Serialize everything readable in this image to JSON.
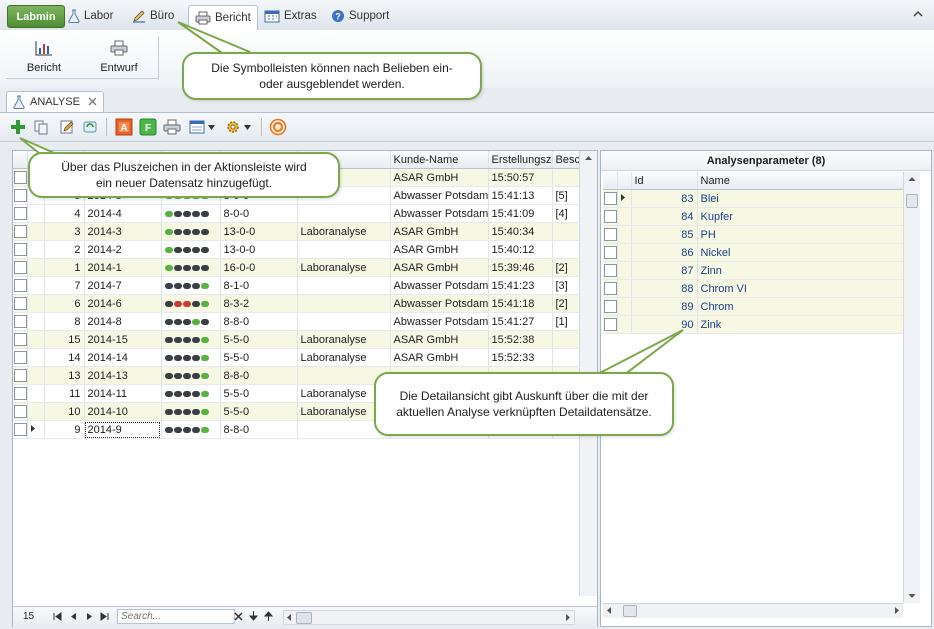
{
  "menu": {
    "app_label": "Labmin",
    "tabs": [
      {
        "label": "Labor",
        "icon": "flask-icon"
      },
      {
        "label": "Büro",
        "icon": "pen-icon"
      },
      {
        "label": "Bericht",
        "icon": "printer-icon"
      },
      {
        "label": "Extras",
        "icon": "calendar-icon"
      },
      {
        "label": "Support",
        "icon": "help-icon"
      }
    ],
    "active_tab": "Bericht"
  },
  "ribbon": {
    "buttons": [
      {
        "label": "Bericht",
        "icon": "chart-icon"
      },
      {
        "label": "Entwurf",
        "icon": "printer-icon"
      }
    ]
  },
  "doc_tab": {
    "label": "ANALYSE",
    "icon": "flask-icon"
  },
  "grid": {
    "columns": [
      "",
      "",
      "",
      "",
      "",
      "",
      "Kunde-Name",
      "Erstellungsze",
      "Besc"
    ],
    "rows": [
      {
        "id": "",
        "code": "",
        "dots": "",
        "status": "",
        "type": "",
        "customer": "ASAR GmbH",
        "time": "15:50:57",
        "desc": "",
        "yellow": true
      },
      {
        "id": "5",
        "code": "2014-5",
        "dots": "ggggg",
        "status": "8-0-0",
        "type": "",
        "customer": "Abwasser Potsdam",
        "time": "15:41:13",
        "desc": "[5]",
        "yellow": false
      },
      {
        "id": "4",
        "code": "2014-4",
        "dots": "gkkkk",
        "status": "8-0-0",
        "type": "",
        "customer": "Abwasser Potsdam",
        "time": "15:41:09",
        "desc": "[4]",
        "yellow": false
      },
      {
        "id": "3",
        "code": "2014-3",
        "dots": "gkkkk",
        "status": "13-0-0",
        "type": "Laboranalyse",
        "customer": "ASAR GmbH",
        "time": "15:40:34",
        "desc": "",
        "yellow": true
      },
      {
        "id": "2",
        "code": "2014-2",
        "dots": "gkkkk",
        "status": "13-0-0",
        "type": "",
        "customer": "ASAR GmbH",
        "time": "15:40:12",
        "desc": "",
        "yellow": false
      },
      {
        "id": "1",
        "code": "2014-1",
        "dots": "gkkkk",
        "status": "16-0-0",
        "type": "Laboranalyse",
        "customer": "ASAR GmbH",
        "time": "15:39:46",
        "desc": "[2]",
        "yellow": true
      },
      {
        "id": "7",
        "code": "2014-7",
        "dots": "kkkkg",
        "status": "8-1-0",
        "type": "",
        "customer": "Abwasser Potsdam",
        "time": "15:41:23",
        "desc": "[3]",
        "yellow": false
      },
      {
        "id": "6",
        "code": "2014-6",
        "dots": "krrkg",
        "status": "8-3-2",
        "type": "",
        "customer": "Abwasser Potsdam",
        "time": "15:41:18",
        "desc": "[2]",
        "yellow": true
      },
      {
        "id": "8",
        "code": "2014-8",
        "dots": "kkkgk",
        "status": "8-8-0",
        "type": "",
        "customer": "Abwasser Potsdam",
        "time": "15:41:27",
        "desc": "[1]",
        "yellow": false
      },
      {
        "id": "15",
        "code": "2014-15",
        "dots": "kkkkg",
        "status": "5-5-0",
        "type": "Laboranalyse",
        "customer": "ASAR GmbH",
        "time": "15:52:38",
        "desc": "",
        "yellow": true
      },
      {
        "id": "14",
        "code": "2014-14",
        "dots": "kkkkg",
        "status": "5-5-0",
        "type": "Laboranalyse",
        "customer": "ASAR GmbH",
        "time": "15:52:33",
        "desc": "",
        "yellow": false
      },
      {
        "id": "13",
        "code": "2014-13",
        "dots": "kkkkg",
        "status": "8-8-0",
        "type": "",
        "customer": "",
        "time": "",
        "desc": "",
        "yellow": true
      },
      {
        "id": "11",
        "code": "2014-11",
        "dots": "kkkkg",
        "status": "5-5-0",
        "type": "Laboranalyse",
        "customer": "",
        "time": "",
        "desc": "",
        "yellow": false
      },
      {
        "id": "10",
        "code": "2014-10",
        "dots": "kkkkg",
        "status": "5-5-0",
        "type": "Laboranalyse",
        "customer": "",
        "time": "",
        "desc": "",
        "yellow": true
      },
      {
        "id": "9",
        "code": "2014-9",
        "dots": "kkkkg",
        "status": "8-8-0",
        "type": "",
        "customer": "",
        "time": "",
        "desc": "",
        "yellow": false,
        "current": true
      }
    ],
    "record_count": "15",
    "search_placeholder": "Search..."
  },
  "detail": {
    "title": "Analysenparameter (8)",
    "columns": [
      "Id",
      "Name"
    ],
    "rows": [
      {
        "id": "83",
        "name": "Blei",
        "current": true
      },
      {
        "id": "84",
        "name": "Kupfer"
      },
      {
        "id": "85",
        "name": "PH"
      },
      {
        "id": "86",
        "name": "Nickel"
      },
      {
        "id": "87",
        "name": "Zinn"
      },
      {
        "id": "88",
        "name": "Chrom VI"
      },
      {
        "id": "89",
        "name": "Chrom"
      },
      {
        "id": "90",
        "name": "Zink"
      }
    ]
  },
  "callouts": {
    "toolbar_hint": "Die Symbolleisten können nach Belieben ein- oder ausgeblendet werden.",
    "plus_hint": "Über das Pluszeichen in der Aktionsleiste wird ein neuer Datensatz hinzugefügt.",
    "detail_hint": "Die Detailansicht gibt Auskunft über die mit der aktuellen Analyse verknüpften Detaildatensätze."
  },
  "colors": {
    "accent_green": "#57b23f",
    "row_yellow": "#f6f8e4",
    "callout_border": "#7aa84a"
  }
}
